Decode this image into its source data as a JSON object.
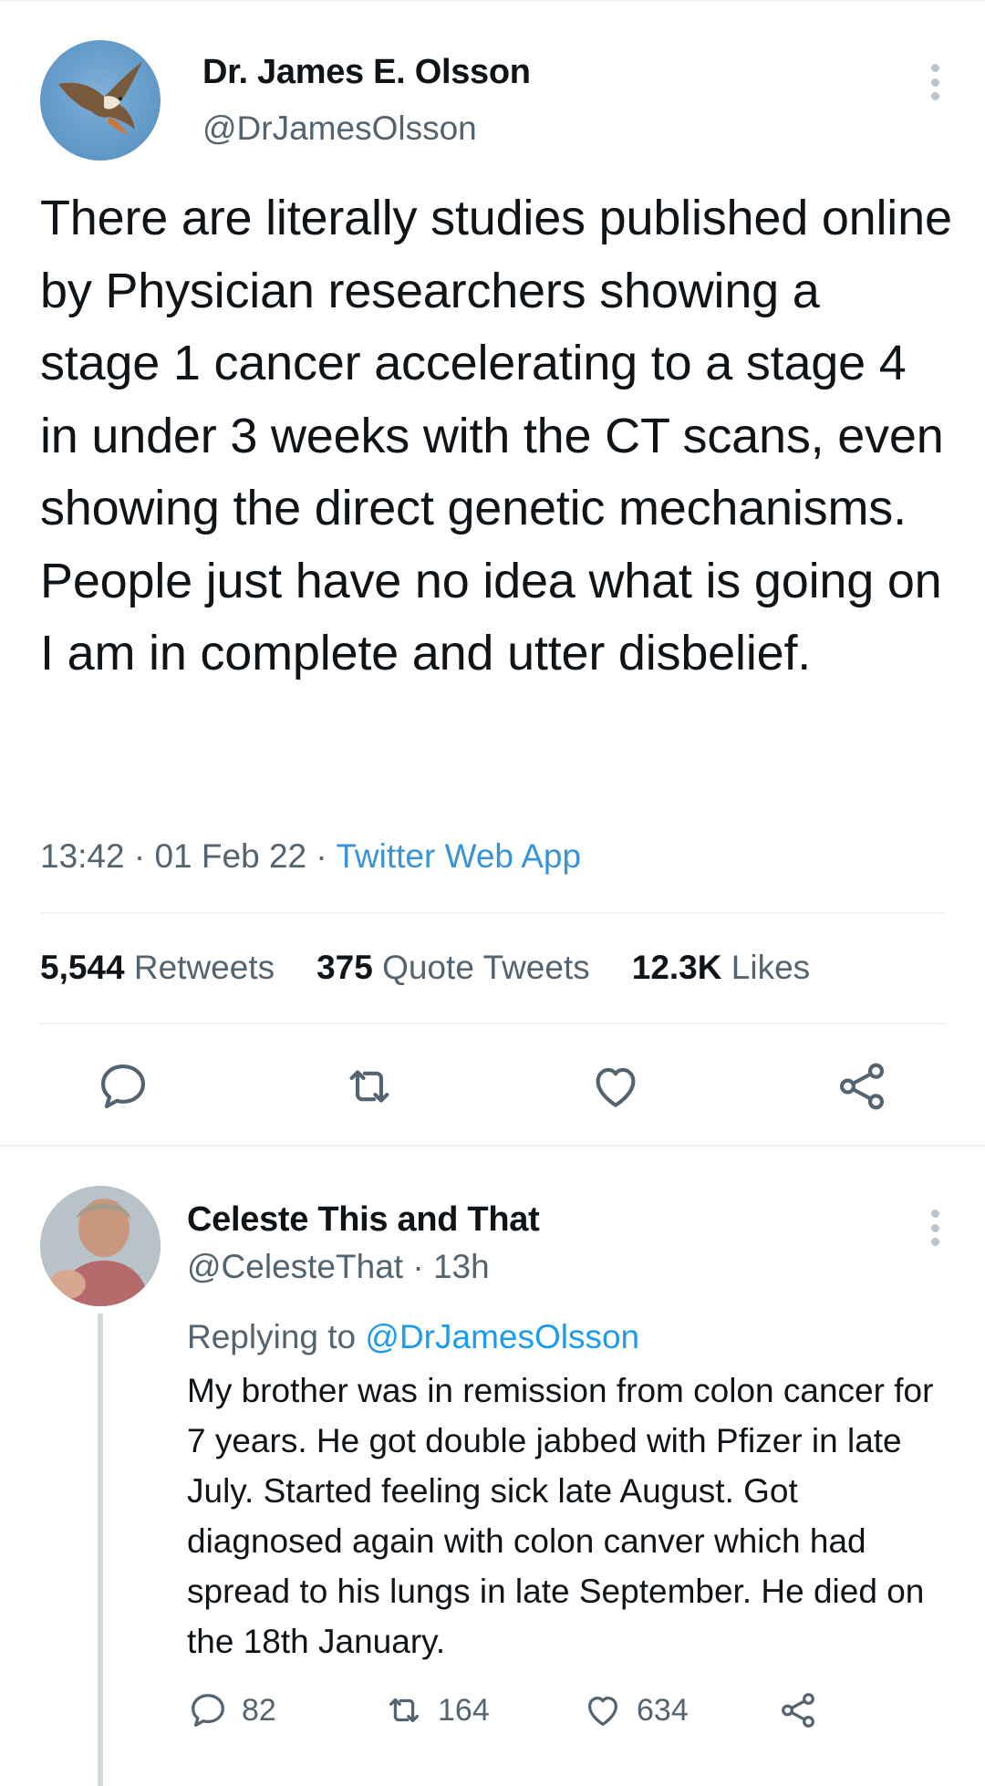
{
  "main_tweet": {
    "author_name": "Dr. James E. Olsson",
    "author_handle": "@DrJamesOlsson",
    "text": "There are literally studies published online by Physician researchers showing a stage 1 cancer accelerating to a stage 4 in under 3 weeks with the CT scans, even showing the direct genetic mechanisms. People just have no idea what is going on I am in complete and utter disbelief.",
    "time": "13:42",
    "separator": "·",
    "date": "01 Feb 22",
    "source": "Twitter Web App",
    "stats": [
      {
        "count": "5,544",
        "label": "Retweets"
      },
      {
        "count": "375",
        "label": "Quote Tweets"
      },
      {
        "count": "12.3K",
        "label": "Likes"
      }
    ],
    "actions": [
      "reply-icon",
      "retweet-icon",
      "like-icon",
      "share-icon"
    ]
  },
  "reply": {
    "author_name": "Celeste This and That",
    "author_handle": "@CelesteThat",
    "separator": "·",
    "age": "13h",
    "replying_prefix": "Replying to",
    "replying_to": "@DrJamesOlsson",
    "text": "My brother was in remission from colon cancer for 7 years. He got double jabbed with Pfizer in late July. Started feeling sick late August. Got diagnosed again with colon canver which had spread to his lungs in late September. He died on the 18th January.",
    "reply_count": "82",
    "retweet_count": "164",
    "like_count": "634"
  },
  "colors": {
    "text": "#0f1419",
    "secondary": "#536471",
    "link": "#1d9bf0",
    "icon": "#536471",
    "divider": "#eff3f4"
  }
}
